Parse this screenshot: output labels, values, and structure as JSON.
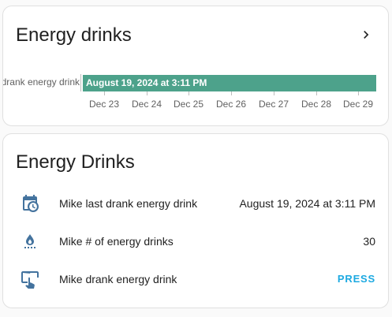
{
  "colors": {
    "accent": "#1ca9e1",
    "icon": "#44739e",
    "timeline_bar": "#4da28b"
  },
  "history_card": {
    "title": "Energy drinks",
    "more_info_icon": "chevron-right-icon",
    "timeline": {
      "entity_label": "Mike last drank energy drink",
      "bar_label": "August 19, 2024 at 3:11 PM",
      "axis_ticks": [
        "Dec 23",
        "Dec 24",
        "Dec 25",
        "Dec 26",
        "Dec 27",
        "Dec 28",
        "Dec 29"
      ]
    }
  },
  "entities_card": {
    "title": "Energy Drinks",
    "rows": [
      {
        "icon": "calendar-clock-icon",
        "name": "Mike last drank energy drink",
        "value": "August 19, 2024 at 3:11 PM"
      },
      {
        "icon": "water-drop-counter-icon",
        "name": "Mike # of energy drinks",
        "value": "30"
      },
      {
        "icon": "gesture-tap-button-icon",
        "name": "Mike drank energy drink",
        "action": "PRESS"
      }
    ]
  }
}
